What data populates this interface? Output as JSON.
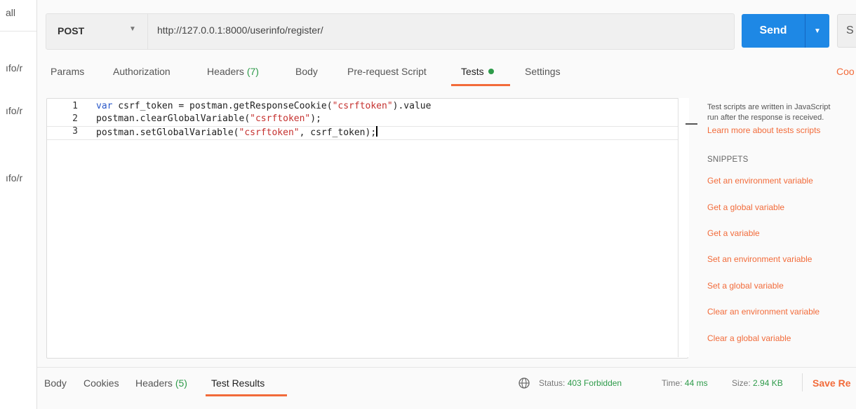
{
  "sidebar": {
    "top_label": "all",
    "rows": [
      "ıfo/r",
      "ıfo/r",
      "ıfo/r"
    ]
  },
  "request": {
    "method": "POST",
    "url": "http://127.0.0.1:8000/userinfo/register/",
    "send_label": "Send",
    "save_label": "S"
  },
  "tabs": {
    "params": "Params",
    "authorization": "Authorization",
    "headers": "Headers",
    "headers_count": "(7)",
    "body": "Body",
    "prerequest": "Pre-request Script",
    "tests": "Tests",
    "settings": "Settings",
    "code": "Coo"
  },
  "editor": {
    "line_numbers": [
      "1",
      "2",
      "3"
    ],
    "line1": {
      "kw": "var",
      "a": " csrf_token = postman.getResponseCookie(",
      "s": "\"csrftoken\"",
      "b": ").value"
    },
    "line2": {
      "a": "postman.clearGlobalVariable(",
      "s": "\"csrftoken\"",
      "b": ");"
    },
    "line3": {
      "a": "postman.setGlobalVariable(",
      "s": "\"csrftoken\"",
      "b": ", csrf_token);"
    }
  },
  "snippets_panel": {
    "help_line1": "Test scripts are written in JavaScript",
    "help_line2": "run after the response is received.",
    "learn_more": "Learn more about tests scripts",
    "title": "SNIPPETS",
    "items": [
      "Get an environment variable",
      "Get a global variable",
      "Get a variable",
      "Set an environment variable",
      "Set a global variable",
      "Clear an environment variable",
      "Clear a global variable"
    ]
  },
  "response": {
    "tabs": {
      "body": "Body",
      "cookies": "Cookies",
      "headers": "Headers",
      "headers_count": "(5)",
      "test_results": "Test Results"
    },
    "status_label": "Status:",
    "status_value": "403 Forbidden",
    "time_label": "Time:",
    "time_value": "44 ms",
    "size_label": "Size:",
    "size_value": "2.94 KB",
    "save_response": "Save Re"
  },
  "colors": {
    "accent": "#f26b3a",
    "send": "#1e88e5",
    "success": "#2e9b4a"
  }
}
